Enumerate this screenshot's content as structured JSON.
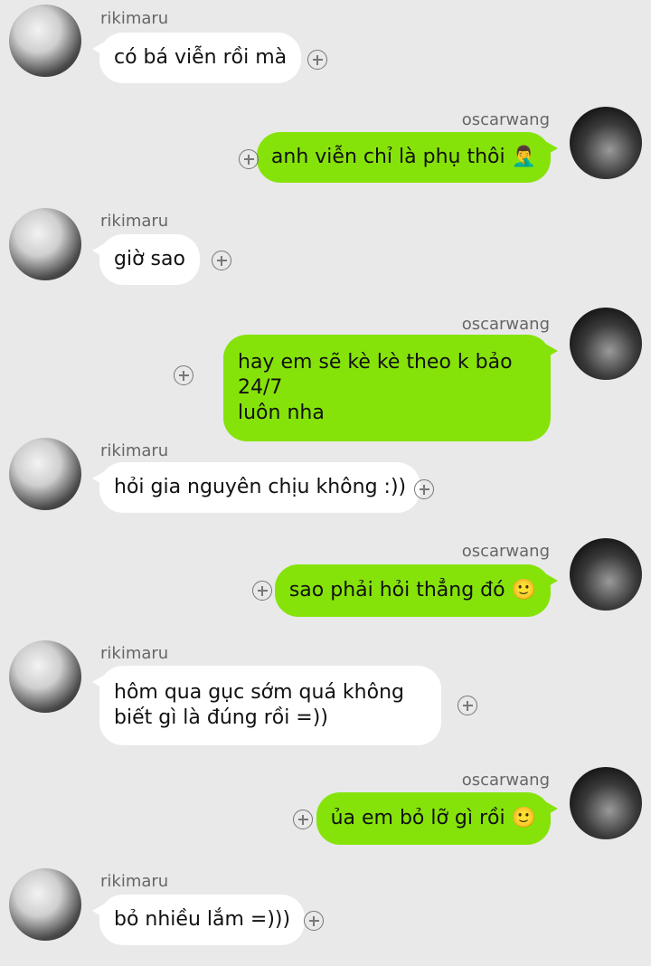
{
  "messages": [
    {
      "side": "left",
      "name": "rikimaru",
      "text": "có bá viễn rồi mà"
    },
    {
      "side": "right",
      "name": "oscarwang",
      "text": "anh viễn chỉ là phụ thôi 🤦‍♂️"
    },
    {
      "side": "left",
      "name": "rikimaru",
      "text": "giờ sao"
    },
    {
      "side": "right",
      "name": "oscarwang",
      "text": "hay em sẽ kè kè theo k bảo 24/7\nluôn nha"
    },
    {
      "side": "left",
      "name": "rikimaru",
      "text": "hỏi gia nguyên chịu không :))"
    },
    {
      "side": "right",
      "name": "oscarwang",
      "text": "sao phải hỏi thẳng đó 🙂"
    },
    {
      "side": "left",
      "name": "rikimaru",
      "text": "hôm qua gục sớm quá không\nbiết gì là đúng rồi =))"
    },
    {
      "side": "right",
      "name": "oscarwang",
      "text": "ủa em bỏ lỡ gì rồi 🙂"
    },
    {
      "side": "left",
      "name": "rikimaru",
      "text": "bỏ nhiều lắm =)))"
    }
  ],
  "colors": {
    "background": "#e9e9e9",
    "outgoing_bubble": "#86e30a",
    "incoming_bubble": "#ffffff"
  },
  "icons": {
    "add_reaction": "plus-circle-icon"
  }
}
